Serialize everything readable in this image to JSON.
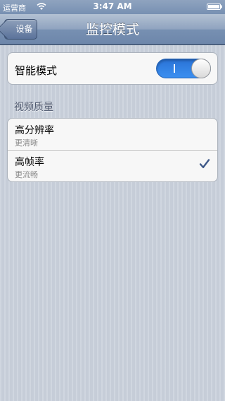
{
  "status_bar": {
    "carrier": "运营商",
    "time": "3:47 AM"
  },
  "nav": {
    "back_label": "设备",
    "title": "监控模式"
  },
  "mode_group": {
    "label": "智能模式",
    "toggle_on": true
  },
  "quality_section": {
    "header": "视频质量",
    "options": [
      {
        "title": "高分辨率",
        "subtitle": "更清晰",
        "selected": false
      },
      {
        "title": "高帧率",
        "subtitle": "更流畅",
        "selected": true
      }
    ]
  },
  "colors": {
    "accent": "#2a73d6",
    "checkmark": "#3d5888",
    "background": "#cbd2dd"
  },
  "icons": {
    "wifi": "wifi-icon",
    "battery": "battery-icon",
    "check": "checkmark-icon"
  }
}
